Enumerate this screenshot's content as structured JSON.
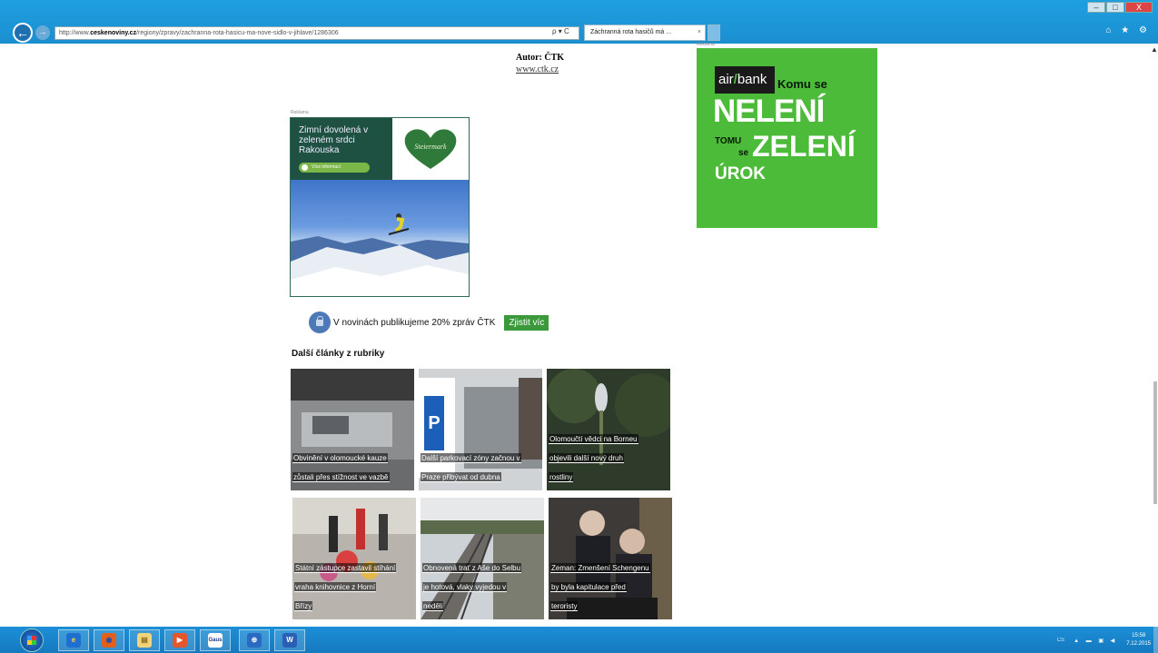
{
  "window": {
    "minimize": "–",
    "maximize": "□",
    "close": "X"
  },
  "browser": {
    "address_prefix": "http://www.",
    "address_domain": "ceskenoviny.cz",
    "address_path": "/regiony/zpravy/zachranna-rota-hasicu-ma-nove-sidlo-v-jihlave/1286306",
    "address_icons": "ρ ▾ C",
    "tab_title": "Záchranná rota hasičů má ...",
    "tab_close": "×",
    "right_icons": "⌂ ★ ⚙"
  },
  "article": {
    "author": "Autor: ČTK",
    "author_link": "www.ctk.cz"
  },
  "ads": {
    "label": "Reklama",
    "austria": {
      "text": "Zimní dovolená v zeleném srdci Rakouska",
      "cta": "Více informací",
      "logo": "Steiermark"
    },
    "airbank": {
      "logo_air": "air",
      "logo_slash": "/",
      "logo_bank": "bank",
      "komu": "Komu se",
      "neleni": "NELENÍ",
      "tomu": "TOMU",
      "se": "se",
      "zeleni": "ZELENÍ",
      "urok": "ÚROK",
      "bg_color": "#4dbb3a"
    }
  },
  "etk_bar": {
    "text": "V novinách publikujeme 20% zpráv ČTK",
    "button": "Zjistit víc",
    "icon": "lock-icon"
  },
  "more_articles": {
    "heading": "Další články z rubriky",
    "items": [
      {
        "line1": "Obvinění v olomoucké kauze",
        "line2": "zůstali přes stížnost ve vazbě"
      },
      {
        "line1": "Další parkovací zóny začnou v",
        "line2": "Praze přibývat od dubna"
      },
      {
        "line1": "Olomoučtí vědci na Borneu",
        "line2": "objevili další nový druh",
        "line3": "rostliny"
      },
      {
        "line1": "Státní zástupce zastavil stíhání",
        "line2": "vraha knihovnice z Horní",
        "line3": "Břízy"
      },
      {
        "line1": "Obnovená trať z Aše do Selbu",
        "line2": "je hotová, vlaky vyjedou v",
        "line3": "neděli"
      },
      {
        "line1": "Zeman: Zmenšení Schengenu",
        "line2": "by byla kapitulace před",
        "line3": "teroristy"
      }
    ]
  },
  "taskbar": {
    "items": [
      {
        "glyph": "e",
        "color": "#1f6fd0",
        "fg": "#ffd24a"
      },
      {
        "glyph": "◉",
        "color": "#e2601c",
        "fg": "#2a4da8"
      },
      {
        "glyph": "▤",
        "color": "#f2d37a",
        "fg": "#8a6a1a"
      },
      {
        "glyph": "▶",
        "color": "#e5572b",
        "fg": "#ffffff"
      },
      {
        "glyph": "Gaus",
        "color": "#ffffff",
        "fg": "#1a3a8a"
      },
      {
        "glyph": "⊕",
        "color": "#2a6ac2",
        "fg": "#ffffff"
      },
      {
        "glyph": "W",
        "color": "#2b5fb5",
        "fg": "#ffffff"
      }
    ],
    "lang": "CS",
    "tray_icons": "▲ ▬ ▣ ◀",
    "time": "15:58",
    "date": "7.12.2015"
  }
}
